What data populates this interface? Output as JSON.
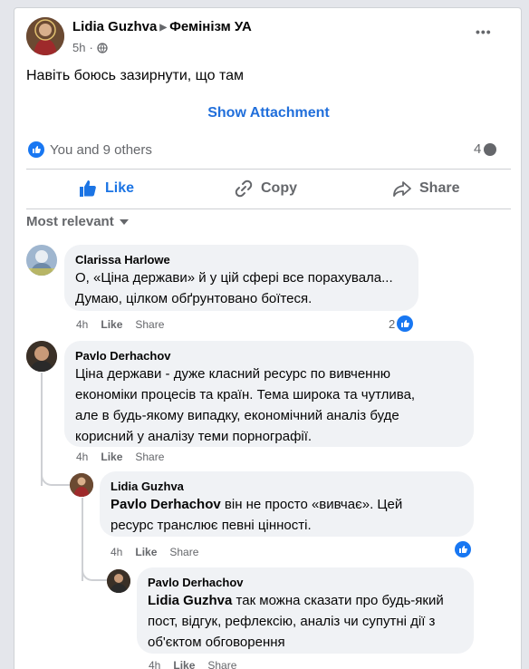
{
  "post": {
    "author": "Lidia Guzhva",
    "group": "Фемінізм УА",
    "time": "5h",
    "more_label": "•••",
    "text": "Навіть боюсь зазирнути, що там",
    "attachment_label": "Show Attachment",
    "reactions_text": "You and 9 others",
    "comments_count": "4"
  },
  "actions": {
    "like": "Like",
    "copy": "Copy",
    "share": "Share"
  },
  "sort_label": "Most relevant",
  "comments": [
    {
      "author": "Clarissa Harlowe",
      "lines": [
        "О, «Ціна держави» й у цій сфері все порахувала...",
        "Думаю, цілком обґрунтовано боїтеся."
      ],
      "time": "4h",
      "like": "Like",
      "share": "Share",
      "reactions": "2"
    },
    {
      "author": "Pavlo Derhachov",
      "lines": [
        "Ціна держави - дуже класний ресурс по вивченню",
        "економіки процесів та країн. Тема широка та чутлива,",
        "але в будь-якому випадку, економічний аналіз буде",
        "корисний у аналізу теми порнографії."
      ],
      "time": "4h",
      "like": "Like",
      "share": "Share"
    }
  ],
  "replies": [
    {
      "author": "Lidia Guzhva",
      "mention": "Pavlo Derhachov",
      "line1_rest": " він не просто «вивчає». Цей",
      "line2": "ресурс транслює певні цінності.",
      "time": "4h",
      "like": "Like",
      "share": "Share"
    },
    {
      "author": "Pavlo Derhachov",
      "mention": "Lidia Guzhva",
      "line1_rest": " так можна сказати про будь-який",
      "line2": "пост, відгук, рефлексію, аналіз чи супутні дії з",
      "line3": "об'єктом обговорення",
      "time": "4h",
      "like": "Like",
      "share": "Share"
    }
  ],
  "colors": {
    "accent": "#1877f2",
    "link": "#216fdb",
    "bubble": "#f0f2f5"
  }
}
